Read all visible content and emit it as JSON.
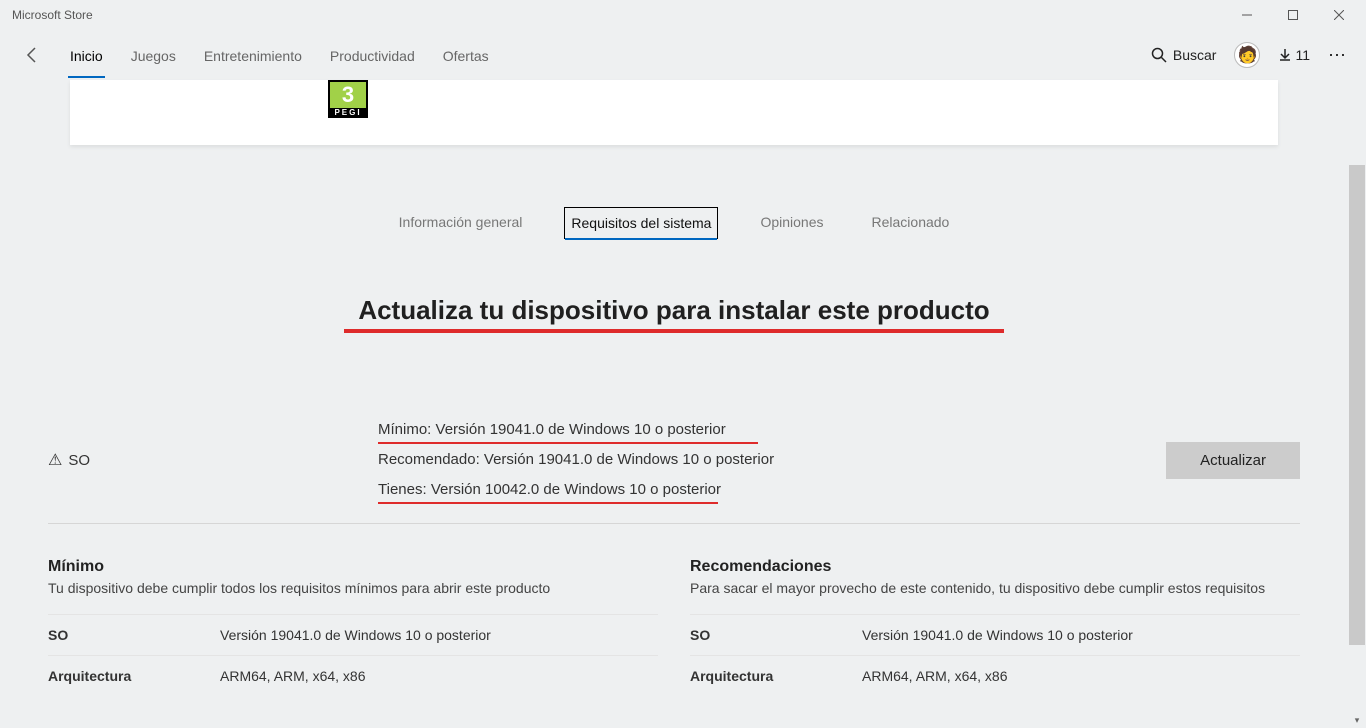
{
  "window_title": "Microsoft Store",
  "nav": {
    "tabs": [
      "Inicio",
      "Juegos",
      "Entretenimiento",
      "Productividad",
      "Ofertas"
    ],
    "active": 0,
    "search_label": "Buscar",
    "downloads_count": "11"
  },
  "pegi": {
    "rating": "3",
    "label": "PEGI"
  },
  "section_tabs": {
    "items": [
      "Información general",
      "Requisitos del sistema",
      "Opiniones",
      "Relacionado"
    ],
    "active": 1
  },
  "headline": "Actualiza tu dispositivo para instalar este producto",
  "requirements": {
    "so_label": "SO",
    "min_label": "Mínimo:",
    "min_value": "Versión 19041.0 de Windows 10 o posterior",
    "rec_label": "Recomendado:",
    "rec_value": "Versión 19041.0 de Windows 10 o posterior",
    "have_label": "Tienes:",
    "have_value": "Versión 10042.0 de Windows 10 o posterior",
    "update_button": "Actualizar"
  },
  "columns": {
    "min": {
      "title": "Mínimo",
      "subtitle": "Tu dispositivo debe cumplir todos los requisitos mínimos para abrir este producto",
      "rows": [
        {
          "k": "SO",
          "v": "Versión 19041.0 de Windows 10 o posterior"
        },
        {
          "k": "Arquitectura",
          "v": "ARM64, ARM, x64, x86"
        }
      ]
    },
    "rec": {
      "title": "Recomendaciones",
      "subtitle": "Para sacar el mayor provecho de este contenido, tu dispositivo debe cumplir estos requisitos",
      "rows": [
        {
          "k": "SO",
          "v": "Versión 19041.0 de Windows 10 o posterior"
        },
        {
          "k": "Arquitectura",
          "v": "ARM64, ARM, x64, x86"
        }
      ]
    }
  }
}
